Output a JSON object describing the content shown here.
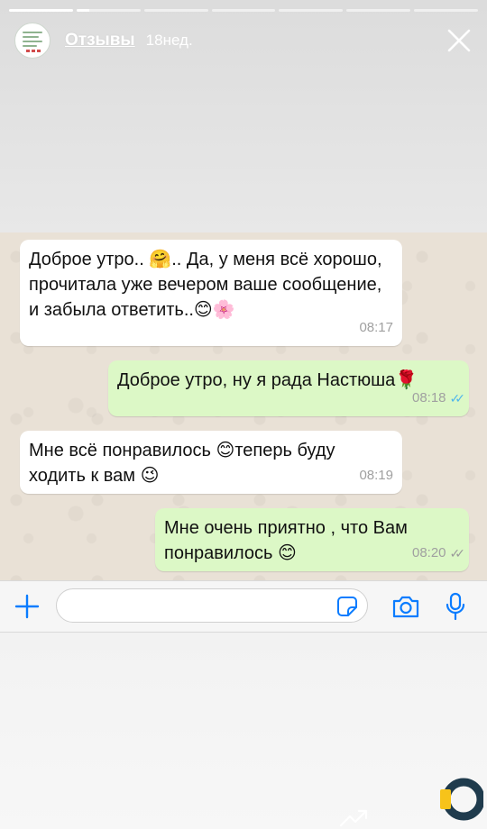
{
  "story": {
    "segments": [
      {
        "progress": 1.0
      },
      {
        "progress": 0.2
      },
      {
        "progress": 0
      },
      {
        "progress": 0
      },
      {
        "progress": 0
      },
      {
        "progress": 0
      },
      {
        "progress": 0
      }
    ],
    "account_name": "Отзывы",
    "time_ago": "18нед."
  },
  "chat": {
    "messages": [
      {
        "direction": "in",
        "text": "Доброе утро.. 🤗.. Да, у меня всё хорошо, прочитала уже вечером ваше сообщение, и забыла ответить..😊🌸",
        "time": "08:17"
      },
      {
        "direction": "out",
        "text": "Доброе утро, ну я рада Настюша🌹",
        "time": "08:18",
        "status": "read"
      },
      {
        "direction": "in",
        "text": "Мне всё понравилось 😊теперь буду ходить к вам 😉",
        "time": "08:19"
      },
      {
        "direction": "out",
        "text": "Мне очень приятно , что Вам понравилось 😊",
        "time": "08:20",
        "status": "delivered"
      }
    ]
  },
  "input": {
    "placeholder": ""
  },
  "colors": {
    "incoming": "#ffffff",
    "outgoing": "#dcf8c6",
    "read_ticks": "#4fb6ec",
    "accent": "#0a7cff"
  },
  "icons": [
    "close-icon",
    "plus-icon",
    "sticker-icon",
    "camera-icon",
    "microphone-icon",
    "share-icon",
    "brand-logo"
  ]
}
